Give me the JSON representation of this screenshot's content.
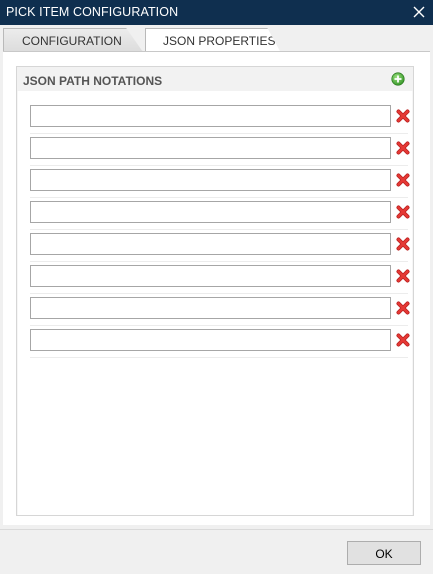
{
  "window": {
    "title": "PICK ITEM CONFIGURATION",
    "close_icon": "close-icon"
  },
  "tabs": [
    {
      "label": "CONFIGURATION",
      "active": false
    },
    {
      "label": "JSON PROPERTIES",
      "active": true
    }
  ],
  "panel": {
    "title": "JSON PATH NOTATIONS",
    "add_icon": "add-circle-icon",
    "add_icon_color": "#4caf50",
    "delete_icon": "delete-x-icon",
    "delete_icon_color": "#e53935",
    "rows": [
      {
        "value": ""
      },
      {
        "value": ""
      },
      {
        "value": ""
      },
      {
        "value": ""
      },
      {
        "value": ""
      },
      {
        "value": ""
      },
      {
        "value": ""
      },
      {
        "value": ""
      }
    ]
  },
  "footer": {
    "ok_label": "OK"
  },
  "colors": {
    "titlebar": "#0f2f4f"
  }
}
